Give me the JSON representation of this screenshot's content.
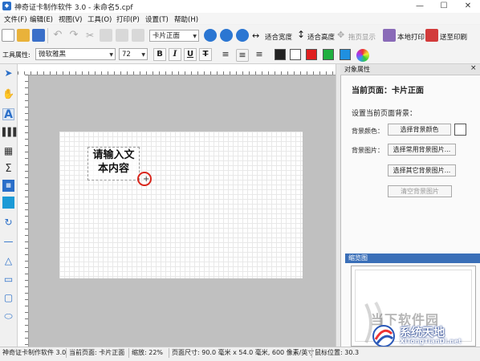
{
  "window": {
    "title": "神奇证卡制作软件 3.0 - 未命名5.cpf",
    "app_icon": "app-icon",
    "controls": [
      "—",
      "☐",
      "✕"
    ]
  },
  "menu": [
    "文件(F)",
    "编辑(E)",
    "视图(V)",
    "工具(O)",
    "打印(P)",
    "设置(T)",
    "帮助(H)"
  ],
  "toolbar": {
    "page_select": "卡片正面",
    "fit_width": "适合宽度",
    "fit_height": "适合高度",
    "pan_display": "拖页显示",
    "local_print": "本地打印",
    "remote_print": "送至印刷"
  },
  "format_bar": {
    "label": "工具属性:",
    "font": "微软雅黑",
    "size": "72",
    "bold": "B",
    "italic": "I",
    "underline": "U",
    "strike": "T",
    "colors": [
      "#222222",
      "#ffffff",
      "#e02020",
      "#20b040",
      "#2090e0"
    ]
  },
  "canvas": {
    "card_bg": "#ffffff",
    "textbox_line1": "请输入文",
    "textbox_line2": "本内容",
    "cursor_glyph": "+"
  },
  "panel": {
    "title": "对象属性",
    "close": "×",
    "current_page": "当前页面：卡片正面",
    "bg_section": "设置当前页面背景：",
    "bg_color_label": "背景颜色：",
    "bg_color_button": "选择背景颜色",
    "bg_image_label": "背景图片：",
    "common_bg_button": "选择常用背景图片...",
    "other_bg_button": "选择其它背景图片...",
    "clear_bg_button": "清空背景图片",
    "preview_title": "缩览图"
  },
  "status": {
    "app": "神奇证卡制作软件 3.0",
    "current_page": "当前页面: 卡片正面",
    "zoom": "缩放: 22%",
    "page_size": "页面尺寸: 90.0 毫米 x 54.0 毫米, 600 像素/英寸",
    "coords": "鼠标位置: 30.3"
  },
  "watermark": {
    "brand": "当下软件园",
    "site_name": "系统天地",
    "site_url": "XiTongTianDi.net"
  }
}
